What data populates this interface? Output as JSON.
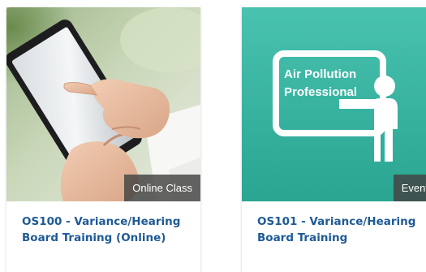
{
  "courses": [
    {
      "title": "OS100 - Variance/Hearing Board Training (Online)",
      "type_badge": "Online Class",
      "image_icon": "tablet-hand-photo"
    },
    {
      "title": "OS101 - Variance/Hearing Board Training",
      "type_badge": "Event",
      "image_icon": "presenter-whiteboard-icon",
      "image_text": [
        "Air Pollution",
        "Professional"
      ]
    }
  ],
  "colors": {
    "title": "#1e5a96",
    "badge_bg": "#424242",
    "teal_top": "#46c0ae",
    "teal_bottom": "#2aa592"
  }
}
